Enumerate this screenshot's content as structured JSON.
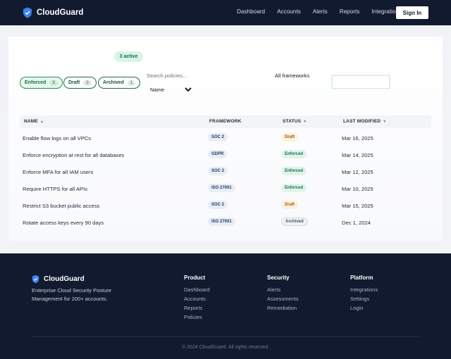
{
  "header": {
    "brand": "CloudGuard",
    "nav": [
      "Dashboard",
      "Accounts",
      "Alerts",
      "Reports",
      "Integrations"
    ],
    "sign_in": "Sign In"
  },
  "summary": {
    "active_badge": "3 active"
  },
  "filters": [
    {
      "label": "Enforced",
      "count": "3"
    },
    {
      "label": "Draft",
      "count": "2"
    },
    {
      "label": "Archived",
      "count": "1"
    }
  ],
  "search": {
    "placeholder": "Search policies..."
  },
  "sort": {
    "selected": "Name"
  },
  "framework_filter": {
    "label": "All frameworks"
  },
  "table": {
    "columns": [
      "NAME",
      "FRAMEWORK",
      "STATUS",
      "LAST MODIFIED"
    ],
    "sort_indicators": {
      "name": "▲",
      "status": "▼",
      "last_modified": "▼"
    },
    "rows": [
      {
        "name": "Enable flow logs on all VPCs",
        "framework": "SOC 2",
        "status": "Draft",
        "modified": "Mar 16, 2025"
      },
      {
        "name": "Enforce encryption at rest for all databases",
        "framework": "GDPR",
        "status": "Enforced",
        "modified": "Mar 14, 2025"
      },
      {
        "name": "Enforce MFA for all IAM users",
        "framework": "SOC 2",
        "status": "Enforced",
        "modified": "Mar 12, 2025"
      },
      {
        "name": "Require HTTPS for all APIs",
        "framework": "ISO 27001",
        "status": "Enforced",
        "modified": "Mar 10, 2025"
      },
      {
        "name": "Restrict S3 bucket public access",
        "framework": "SOC 2",
        "status": "Draft",
        "modified": "Mar 15, 2025"
      },
      {
        "name": "Rotate access keys every 90 days",
        "framework": "ISO 27001",
        "status": "Archived",
        "modified": "Dec 1, 2024"
      }
    ]
  },
  "footer": {
    "brand": "CloudGuard",
    "tagline": "Enterprise Cloud Security Posture Management for 200+ accounts.",
    "columns": [
      {
        "title": "Product",
        "links": [
          "Dashboard",
          "Accounts",
          "Reports",
          "Policies"
        ]
      },
      {
        "title": "Security",
        "links": [
          "Alerts",
          "Assessments",
          "Remediation"
        ]
      },
      {
        "title": "Platform",
        "links": [
          "Integrations",
          "Settings",
          "Login"
        ]
      }
    ],
    "copyright": "© 2024 CloudGuard. All rights reserved."
  },
  "colors": {
    "header_bg": "#111a2e",
    "accent_green": "#2a8b5d",
    "shield_blue": "#3b82f6"
  }
}
